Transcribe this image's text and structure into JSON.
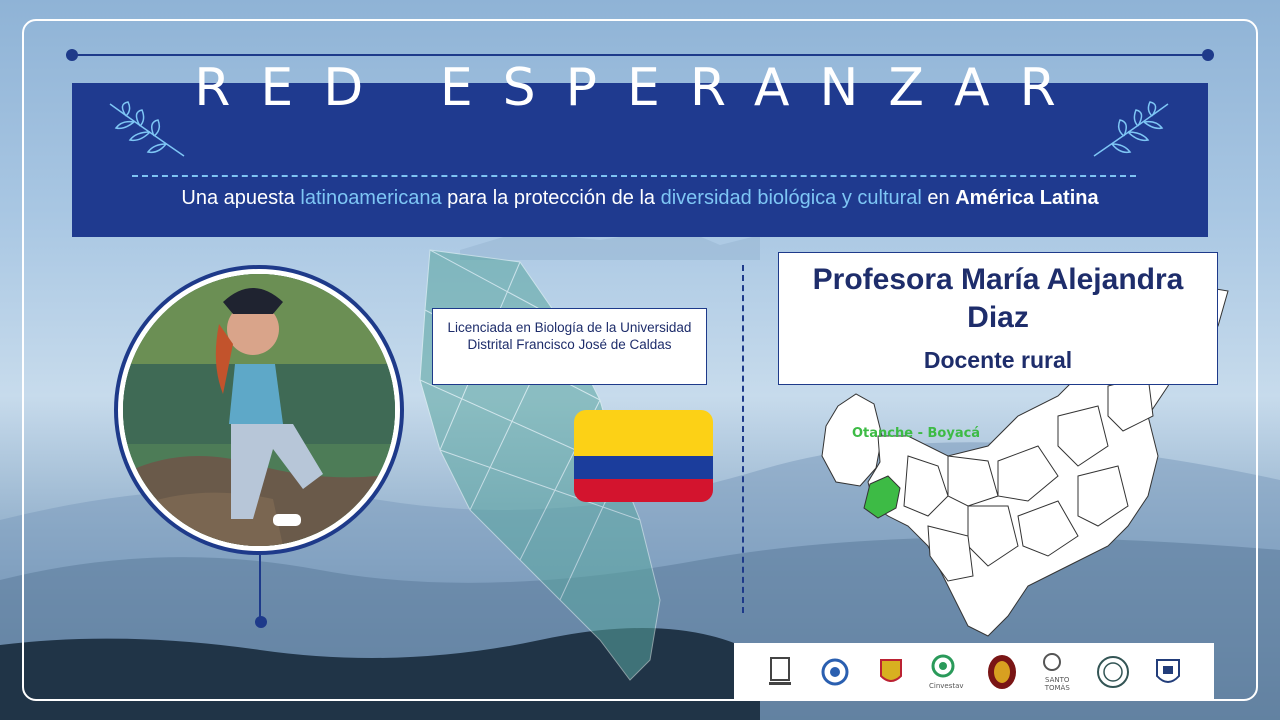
{
  "header": {
    "title": "RED ESPERANZAR",
    "subtitle": {
      "part1": "Una apuesta ",
      "hl1": "latinoamericana",
      "part2": " para la protección de la ",
      "hl2": "diversidad biológica y cultural",
      "part3": " en ",
      "strong": "América Latina"
    }
  },
  "profile": {
    "degree": "Licenciada en Biología de la Universidad Distrital Francisco José de Caldas",
    "name": "Profesora María Alejandra Diaz",
    "role": "Docente rural",
    "location_label": "Otanche - Boyacá"
  },
  "colors": {
    "banner": "#1f3a8f",
    "accent_blue": "#7ec6f5",
    "highlight_green": "#3dbb45",
    "flag_yellow": "#fcd116",
    "flag_blue": "#1b3d9c",
    "flag_red": "#d3142e"
  },
  "logos": {
    "santo_tomas": "SANTO TOMÁS",
    "cinvestav": "Cinvestav"
  },
  "icons": [
    "leaf-branch-icon",
    "colombia-flag-icon",
    "boyaca-map-icon"
  ]
}
